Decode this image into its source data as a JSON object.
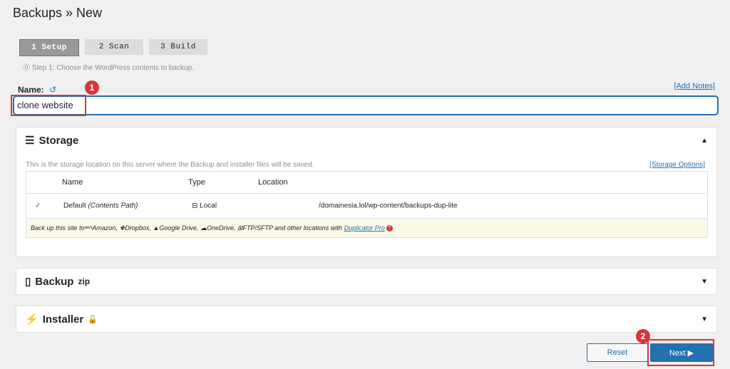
{
  "page": {
    "title": "Backups » New"
  },
  "steps": [
    {
      "label": "1 Setup"
    },
    {
      "label": "2 Scan"
    },
    {
      "label": "3 Build"
    }
  ],
  "step_description": "Step 1: Choose the WordPress contents to backup.",
  "name": {
    "label": "Name:",
    "value": "clone website",
    "add_notes": "[Add Notes]"
  },
  "annotations": {
    "badge1": "1",
    "badge2": "2"
  },
  "storage": {
    "title": "Storage",
    "description": "This is the storage location on this server where the Backup and installer files will be saved.",
    "options_link": "[Storage Options]",
    "columns": [
      "Name",
      "Type",
      "Location"
    ],
    "rows": [
      {
        "name": "Default",
        "name_note": "(Contents Path)",
        "type": "Local",
        "location": "/domainesia.lol/wp-content/backups-dup-lite"
      }
    ],
    "promo": {
      "text": "Back up this site to ",
      "amazon": "Amazon,",
      "dropbox": "Dropbox,",
      "gdrive": "Google Drive,",
      "onedrive": "OneDrive,",
      "ftp": "FTP/SFTP and other locations with",
      "link": "Duplicator Pro"
    }
  },
  "backup_panel": {
    "title": "Backup",
    "sup": "zip"
  },
  "installer_panel": {
    "title": "Installer"
  },
  "buttons": {
    "reset": "Reset",
    "next": "Next ▶"
  }
}
